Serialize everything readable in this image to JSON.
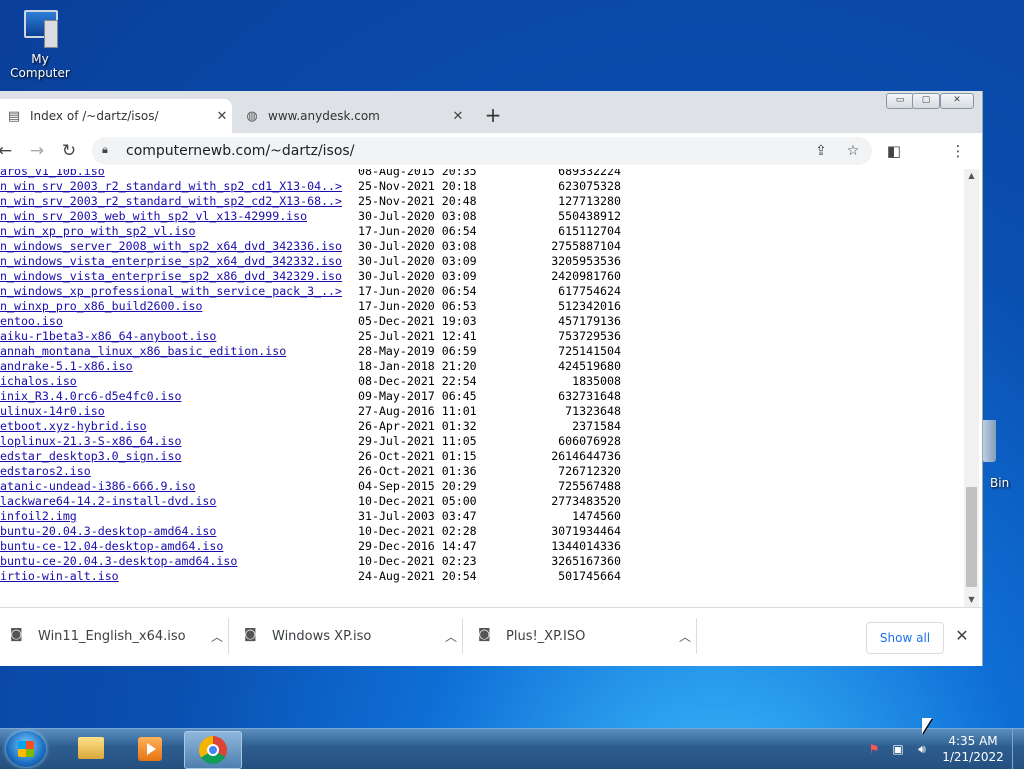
{
  "desktop": {
    "icons": [
      {
        "label": "My Computer",
        "icon": "computer-icon"
      },
      {
        "label": "Bin",
        "icon": "recycle-bin-icon"
      }
    ]
  },
  "browser": {
    "tabs": [
      {
        "label": "Index of /~dartz/isos/",
        "icon": "page-icon",
        "active": true
      },
      {
        "label": "www.anydesk.com",
        "icon": "globe-icon",
        "active": false
      }
    ],
    "new_tab": "+",
    "window_controls": {
      "minimize": "▭",
      "maximize": "▢",
      "close": "✕"
    },
    "url": "computernewb.com/~dartz/isos/"
  },
  "listing": [
    {
      "name": "aros_v1_10b.iso",
      "date": "08-Aug-2015 20:35",
      "size": "689332224"
    },
    {
      "name": "n_win_srv_2003_r2_standard_with_sp2_cd1_X13-04..>",
      "date": "25-Nov-2021 20:18",
      "size": "623075328"
    },
    {
      "name": "n_win_srv_2003_r2_standard_with_sp2_cd2_X13-68..>",
      "date": "25-Nov-2021 20:48",
      "size": "127713280"
    },
    {
      "name": "n_win_srv_2003_web_with_sp2_vl_x13-42999.iso",
      "date": "30-Jul-2020 03:08",
      "size": "550438912"
    },
    {
      "name": "n_win_xp_pro_with_sp2_vl.iso",
      "date": "17-Jun-2020 06:54",
      "size": "615112704"
    },
    {
      "name": "n_windows_server_2008_with_sp2_x64_dvd_342336.iso",
      "date": "30-Jul-2020 03:08",
      "size": "2755887104"
    },
    {
      "name": "n_windows_vista_enterprise_sp2_x64_dvd_342332.iso",
      "date": "30-Jul-2020 03:09",
      "size": "3205953536"
    },
    {
      "name": "n_windows_vista_enterprise_sp2_x86_dvd_342329.iso",
      "date": "30-Jul-2020 03:09",
      "size": "2420981760"
    },
    {
      "name": "n_windows_xp_professional_with_service_pack_3_..>",
      "date": "17-Jun-2020 06:54",
      "size": "617754624"
    },
    {
      "name": "n_winxp_pro_x86_build2600.iso",
      "date": "17-Jun-2020 06:53",
      "size": "512342016"
    },
    {
      "name": "entoo.iso",
      "date": "05-Dec-2021 19:03",
      "size": "457179136"
    },
    {
      "name": "aiku-r1beta3-x86_64-anyboot.iso",
      "date": "25-Jul-2021 12:41",
      "size": "753729536"
    },
    {
      "name": "annah_montana_linux_x86_basic_edition.iso",
      "date": "28-May-2019 06:59",
      "size": "725141504"
    },
    {
      "name": "andrake-5.1-x86.iso",
      "date": "18-Jan-2018 21:20",
      "size": "424519680"
    },
    {
      "name": "ichalos.iso",
      "date": "08-Dec-2021 22:54",
      "size": "1835008"
    },
    {
      "name": "inix_R3.4.0rc6-d5e4fc0.iso",
      "date": "09-May-2017 06:45",
      "size": "632731648"
    },
    {
      "name": "ulinux-14r0.iso",
      "date": "27-Aug-2016 11:01",
      "size": "71323648"
    },
    {
      "name": "etboot.xyz-hybrid.iso",
      "date": "26-Apr-2021 01:32",
      "size": "2371584"
    },
    {
      "name": "loplinux-21.3-S-x86_64.iso",
      "date": "29-Jul-2021 11:05",
      "size": "606076928"
    },
    {
      "name": "edstar_desktop3.0_sign.iso",
      "date": "26-Oct-2021 01:15",
      "size": "2614644736"
    },
    {
      "name": "edstaros2.iso",
      "date": "26-Oct-2021 01:36",
      "size": "726712320"
    },
    {
      "name": "atanic-undead-i386-666.9.iso",
      "date": "04-Sep-2015 20:29",
      "size": "725567488"
    },
    {
      "name": "lackware64-14.2-install-dvd.iso",
      "date": "10-Dec-2021 05:00",
      "size": "2773483520"
    },
    {
      "name": "infoil2.img",
      "date": "31-Jul-2003 03:47",
      "size": "1474560"
    },
    {
      "name": "buntu-20.04.3-desktop-amd64.iso",
      "date": "10-Dec-2021 02:28",
      "size": "3071934464"
    },
    {
      "name": "buntu-ce-12.04-desktop-amd64.iso",
      "date": "29-Dec-2016 14:47",
      "size": "1344014336"
    },
    {
      "name": "buntu-ce-20.04.3-desktop-amd64.iso",
      "date": "10-Dec-2021 02:23",
      "size": "3265167360"
    },
    {
      "name": "irtio-win-alt.iso",
      "date": "24-Aug-2021 20:54",
      "size": "501745664"
    }
  ],
  "downloads": {
    "items": [
      {
        "name": "Win11_English_x64.iso"
      },
      {
        "name": "Windows XP.iso"
      },
      {
        "name": "Plus!_XP.ISO"
      }
    ],
    "show_all": "Show all"
  },
  "taskbar": {
    "clock_time": "4:35 AM",
    "clock_date": "1/21/2022"
  }
}
